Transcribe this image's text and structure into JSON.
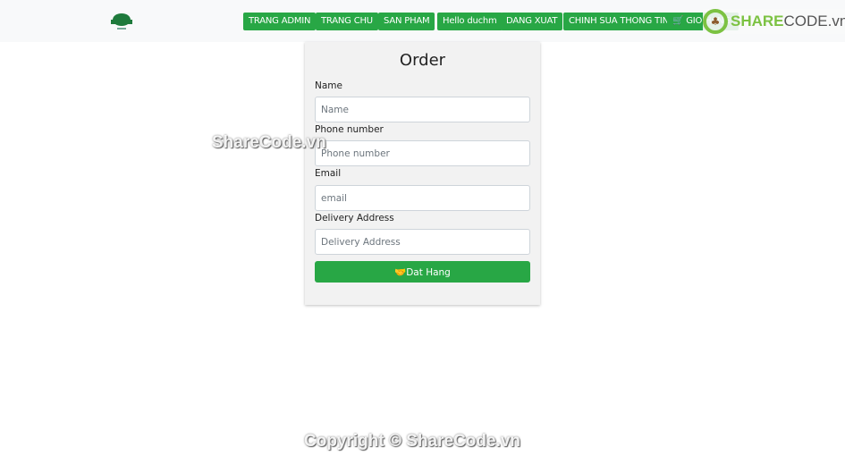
{
  "nav": {
    "items": [
      "TRANG ADMIN",
      "TRANG CHU",
      "SAN PHAM",
      "Hello duchm",
      "DANG XUAT",
      "CHINH SUA THONG TIN",
      "GIO HANG"
    ],
    "accent": "#28a745"
  },
  "form": {
    "title": "Order",
    "fields": [
      {
        "label": "Name",
        "placeholder": "Name"
      },
      {
        "label": "Phone number",
        "placeholder": "Phone number"
      },
      {
        "label": "Email",
        "placeholder": "email"
      },
      {
        "label": "Delivery Address",
        "placeholder": "Delivery Address"
      }
    ],
    "submit": "Dat Hang"
  },
  "watermark": {
    "center": "ShareCode.vn",
    "footer": "Copyright © ShareCode.vn",
    "logo_a": "SHARE",
    "logo_b": "CODE.vn"
  }
}
